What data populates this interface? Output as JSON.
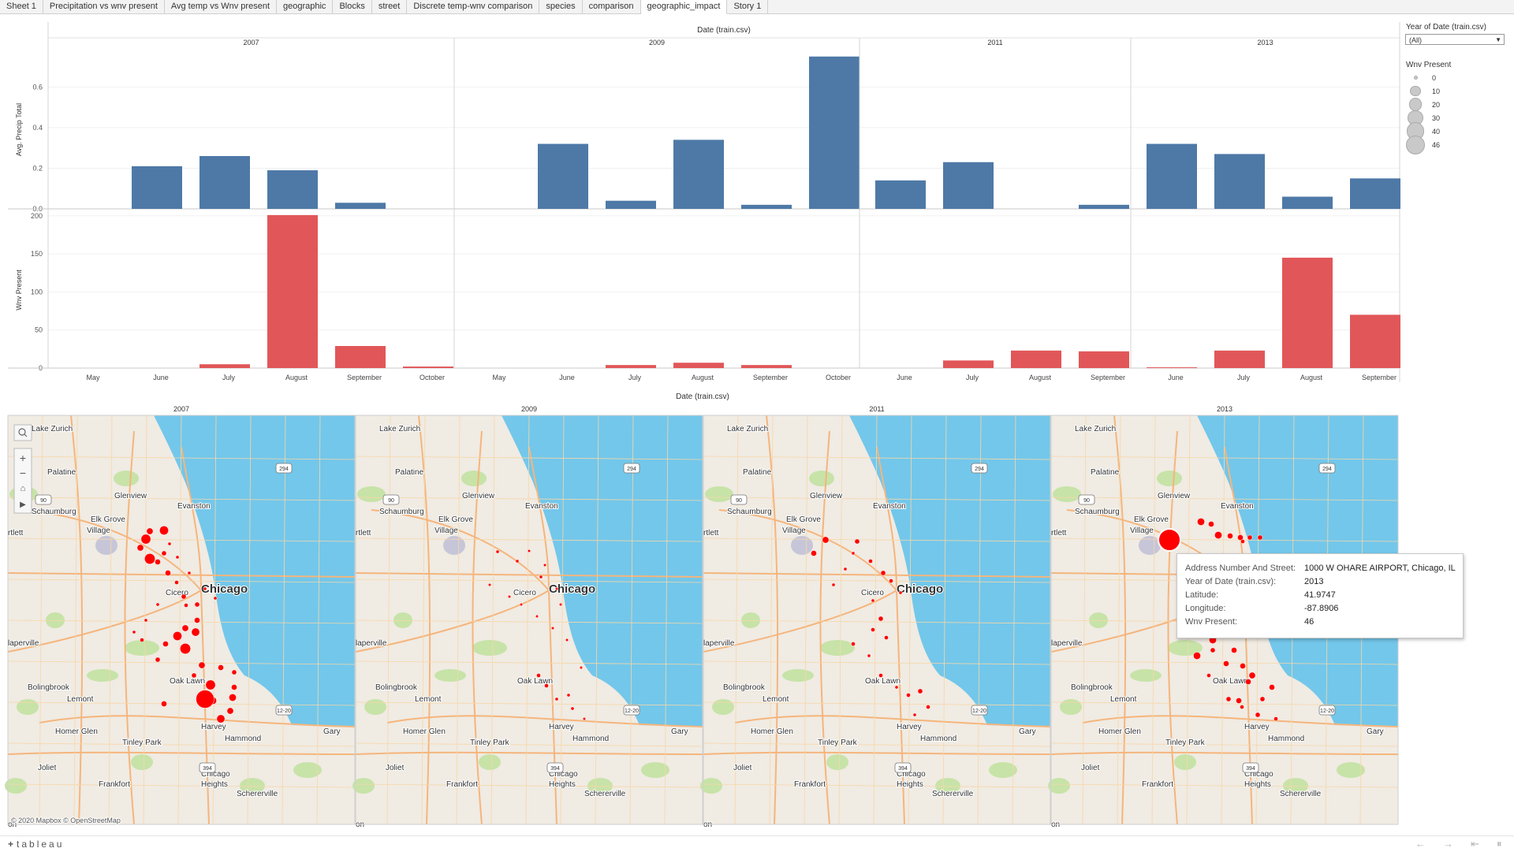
{
  "tabs": [
    {
      "label": "Sheet 1"
    },
    {
      "label": "Precipitation vs wnv present"
    },
    {
      "label": "Avg temp vs Wnv present"
    },
    {
      "label": "geographic"
    },
    {
      "label": "Blocks"
    },
    {
      "label": "street"
    },
    {
      "label": "Discrete temp-wnv comparison"
    },
    {
      "label": "species"
    },
    {
      "label": "comparison"
    },
    {
      "label": "geographic_impact",
      "active": true
    },
    {
      "label": "Story 1"
    }
  ],
  "charts": {
    "column_header_title": "Date (train.csv)",
    "x_axis_title": "Date (train.csv)",
    "precip_axis_title": "Avg. Precip Total",
    "wnv_axis_title": "Wnv Present",
    "precip_ticks": [
      "0.0",
      "0.2",
      "0.4",
      "0.6"
    ],
    "wnv_ticks": [
      "0",
      "50",
      "100",
      "150",
      "200"
    ],
    "precip_color": "#4e79a7",
    "wnv_color": "#e15759"
  },
  "chart_data": [
    {
      "type": "bar",
      "title": "",
      "ylabel": "Avg. Precip Total",
      "xlabel": "Date (train.csv)",
      "ylim": [
        0,
        0.78
      ],
      "panels": [
        {
          "year": "2007",
          "categories": [
            "May",
            "June",
            "July",
            "August",
            "September",
            "October"
          ],
          "values": [
            0,
            0.21,
            0.26,
            0.19,
            0.03,
            0
          ]
        },
        {
          "year": "2009",
          "categories": [
            "May",
            "June",
            "July",
            "August",
            "September",
            "October"
          ],
          "values": [
            0,
            0.32,
            0.04,
            0.34,
            0.02,
            0.75
          ]
        },
        {
          "year": "2011",
          "categories": [
            "June",
            "July",
            "August",
            "September"
          ],
          "values": [
            0.14,
            0.23,
            0,
            0.02
          ]
        },
        {
          "year": "2013",
          "categories": [
            "June",
            "July",
            "August",
            "September"
          ],
          "values": [
            0.32,
            0.27,
            0.06,
            0.15
          ]
        }
      ]
    },
    {
      "type": "bar",
      "title": "",
      "ylabel": "Wnv Present",
      "xlabel": "Date (train.csv)",
      "ylim": [
        0,
        205
      ],
      "panels": [
        {
          "year": "2007",
          "categories": [
            "May",
            "June",
            "July",
            "August",
            "September",
            "October"
          ],
          "values": [
            0,
            0,
            5,
            201,
            29,
            2
          ]
        },
        {
          "year": "2009",
          "categories": [
            "May",
            "June",
            "July",
            "August",
            "September",
            "October"
          ],
          "values": [
            0,
            0,
            4,
            7,
            4,
            0
          ]
        },
        {
          "year": "2011",
          "categories": [
            "June",
            "July",
            "August",
            "September"
          ],
          "values": [
            0,
            10,
            23,
            22
          ]
        },
        {
          "year": "2013",
          "categories": [
            "June",
            "July",
            "August",
            "September"
          ],
          "values": [
            1,
            23,
            145,
            70
          ]
        }
      ]
    }
  ],
  "maps": {
    "years": [
      "2007",
      "2009",
      "2011",
      "2013"
    ],
    "places": [
      "Lake Zurich",
      "Palatine",
      "Glenview",
      "Evanston",
      "Schaumburg",
      "Elk Grove",
      "Village",
      "rtlett",
      "Chicago",
      "Cicero",
      "laperville",
      "Oak Lawn",
      "Bolingbrook",
      "Lemont",
      "Harvey",
      "Homer Glen",
      "Tinley Park",
      "Hammond",
      "Gary",
      "Joliet",
      "Chicago",
      "Heights",
      "Frankfort",
      "Schererville",
      "on"
    ],
    "highways": [
      "294",
      "90",
      "12-20",
      "394"
    ],
    "attribution": "© 2020 Mapbox © OpenStreetMap",
    "land_color": "#f0ebe3",
    "water_color": "#73c7ea",
    "point_color": "#ff0000"
  },
  "filter": {
    "title": "Year of Date (train.csv)",
    "value": "(All)"
  },
  "legend": {
    "title": "Wnv Present",
    "items": [
      {
        "label": "0",
        "value": 0
      },
      {
        "label": "10",
        "value": 10
      },
      {
        "label": "20",
        "value": 20
      },
      {
        "label": "30",
        "value": 30
      },
      {
        "label": "40",
        "value": 40
      },
      {
        "label": "46",
        "value": 46
      }
    ]
  },
  "tooltip": {
    "rows": [
      {
        "label": "Address Number And Street:",
        "value": "1000 W OHARE AIRPORT, Chicago, IL"
      },
      {
        "label": "Year of Date (train.csv):",
        "value": "2013"
      },
      {
        "label": "Latitude:",
        "value": "41.9747"
      },
      {
        "label": "Longitude:",
        "value": "-87.8906"
      },
      {
        "label": "Wnv Present:",
        "value": "46"
      }
    ]
  },
  "footer": {
    "logo": "tableau",
    "logo_mark": "+"
  }
}
